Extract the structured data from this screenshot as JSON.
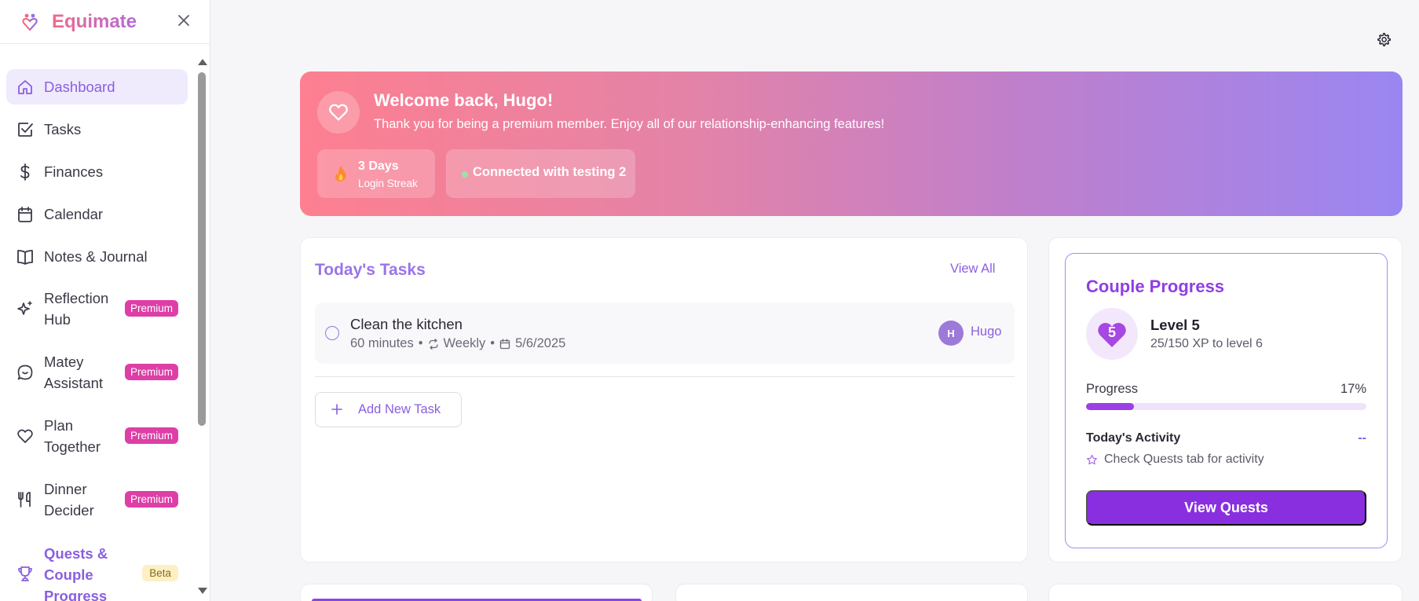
{
  "brand": {
    "name": "Equimate"
  },
  "nav": {
    "items": [
      {
        "label": "Dashboard"
      },
      {
        "label": "Tasks"
      },
      {
        "label": "Finances"
      },
      {
        "label": "Calendar"
      },
      {
        "label": "Notes & Journal"
      },
      {
        "label_line1": "Reflection",
        "label_line2": "Hub",
        "badge": "Premium"
      },
      {
        "label_line1": "Matey",
        "label_line2": "Assistant",
        "badge": "Premium"
      },
      {
        "label_line1": "Plan",
        "label_line2": "Together",
        "badge": "Premium"
      },
      {
        "label_line1": "Dinner",
        "label_line2": "Decider",
        "badge": "Premium"
      },
      {
        "label_line1": "Quests &",
        "label_line2": "Couple",
        "label_line3": "Progress",
        "badge": "Beta"
      }
    ]
  },
  "hero": {
    "title": "Welcome back, Hugo!",
    "subtitle": "Thank you for being a premium member. Enjoy all of our relationship-enhancing features!",
    "streak_value": "3 Days",
    "streak_label": "Login Streak",
    "connection_label": "Connected with testing 2"
  },
  "tasks": {
    "title": "Today's Tasks",
    "view_all": "View All",
    "items": [
      {
        "name": "Clean the kitchen",
        "duration": "60 minutes",
        "recurrence": "Weekly",
        "date": "5/6/2025",
        "assignee_initial": "H",
        "assignee_name": "Hugo"
      }
    ],
    "add_label": "Add New Task"
  },
  "progress": {
    "title": "Couple Progress",
    "level_number": "5",
    "level_title": "Level 5",
    "xp_text": "25/150 XP to level 6",
    "progress_label": "Progress",
    "progress_percent_text": "17%",
    "progress_fraction": 0.17,
    "activity_label": "Today's Activity",
    "activity_value": "--",
    "activity_hint": "Check Quests tab for activity",
    "button_label": "View Quests"
  },
  "colors": {
    "accent": "#8a5fe0",
    "premium_badge": "#dd3fa6",
    "primary_button": "#8a2fe0"
  },
  "icons": {
    "nav": [
      "home-icon",
      "check-square-icon",
      "dollar-icon",
      "calendar-icon",
      "book-icon",
      "sparkles-icon",
      "chat-bubble-icon",
      "heart-icon",
      "utensils-icon",
      "trophy-icon"
    ],
    "settings": "gear-icon",
    "close": "close-icon"
  }
}
